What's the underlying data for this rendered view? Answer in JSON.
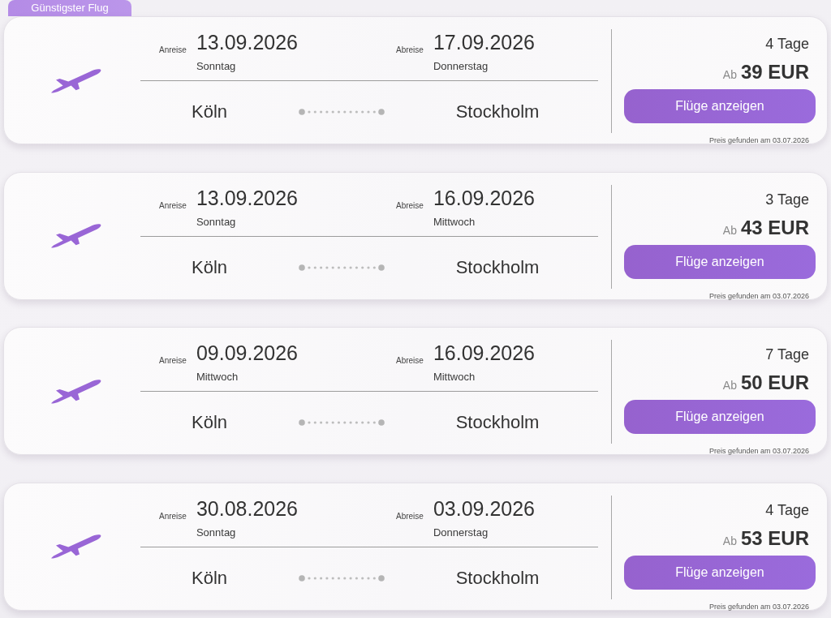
{
  "flights": [
    {
      "badge": "Günstigster Flug",
      "outbound": {
        "label": "Anreise",
        "date": "13.09.2026",
        "weekday": "Sonntag"
      },
      "inbound": {
        "label": "Abreise",
        "date": "17.09.2026",
        "weekday": "Donnerstag"
      },
      "origin": "Köln",
      "destination": "Stockholm",
      "duration": "4 Tage",
      "price_prefix": "Ab",
      "price": "39 EUR",
      "button": "Flüge anzeigen",
      "found_note": "Preis gefunden am 03.07.2026"
    },
    {
      "outbound": {
        "label": "Anreise",
        "date": "13.09.2026",
        "weekday": "Sonntag"
      },
      "inbound": {
        "label": "Abreise",
        "date": "16.09.2026",
        "weekday": "Mittwoch"
      },
      "origin": "Köln",
      "destination": "Stockholm",
      "duration": "3 Tage",
      "price_prefix": "Ab",
      "price": "43 EUR",
      "button": "Flüge anzeigen",
      "found_note": "Preis gefunden am 03.07.2026"
    },
    {
      "outbound": {
        "label": "Anreise",
        "date": "09.09.2026",
        "weekday": "Mittwoch"
      },
      "inbound": {
        "label": "Abreise",
        "date": "16.09.2026",
        "weekday": "Mittwoch"
      },
      "origin": "Köln",
      "destination": "Stockholm",
      "duration": "7 Tage",
      "price_prefix": "Ab",
      "price": "50 EUR",
      "button": "Flüge anzeigen",
      "found_note": "Preis gefunden am 03.07.2026"
    },
    {
      "outbound": {
        "label": "Anreise",
        "date": "30.08.2026",
        "weekday": "Sonntag"
      },
      "inbound": {
        "label": "Abreise",
        "date": "03.09.2026",
        "weekday": "Donnerstag"
      },
      "origin": "Köln",
      "destination": "Stockholm",
      "duration": "4 Tage",
      "price_prefix": "Ab",
      "price": "53 EUR",
      "button": "Flüge anzeigen",
      "found_note": "Preis gefunden am 03.07.2026"
    }
  ]
}
